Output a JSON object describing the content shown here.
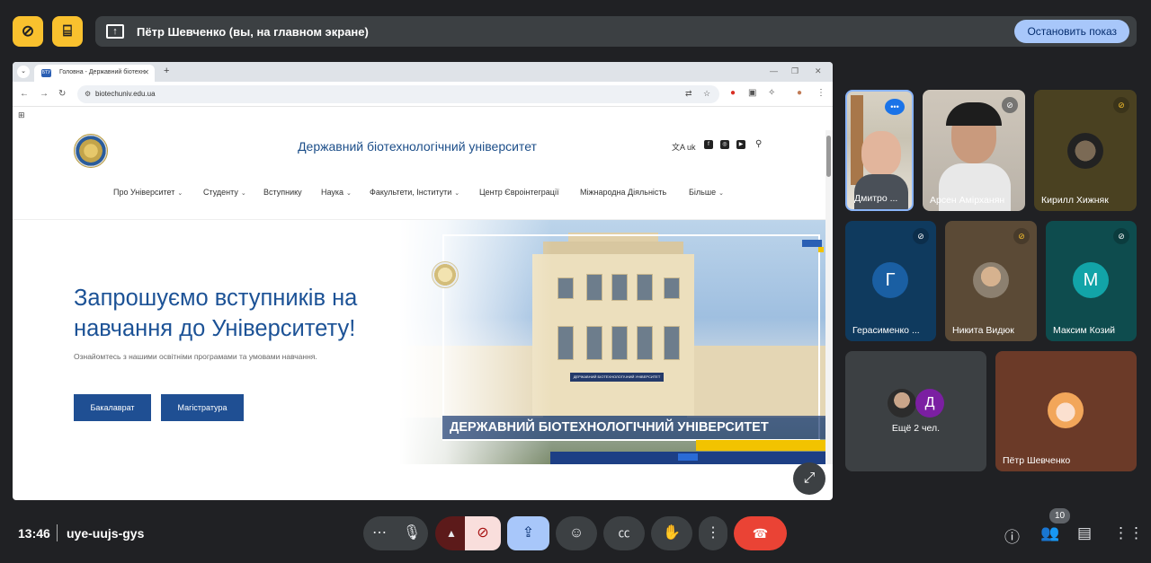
{
  "topbar": {
    "btn1_icon": "screen-share-off-icon",
    "btn2_icon": "door-icon",
    "present_icon": "present-to-all-icon",
    "present_text": "Пётр Шевченко (вы, на главном экране)",
    "stop_label": "Остановить показ"
  },
  "browser": {
    "tab_title": "Головна - Державний біотехн",
    "tab_favicon": "БТУ",
    "url": "biotechuniv.edu.ua"
  },
  "site": {
    "title": "Державний біотехнологічний університет",
    "lang": "uk",
    "menu": [
      "Про Університет",
      "Студенту",
      "Вступнику",
      "Наука",
      "Факультети, Інститути",
      "Центр Євроінтеграції",
      "Міжнародна Діяльність",
      "Більше"
    ],
    "hero_heading": "Запрошуємо вступників на навчання до Університету!",
    "hero_sub": "Ознайомтесь з нашими освітніми програмами та умовами навчання.",
    "btn_bachelor": "Бакалаврат",
    "btn_master": "Магістратура",
    "hero_banner": "ДЕРЖАВНИЙ БІОТЕХНОЛОГІЧНИЙ УНІВЕРСИТЕТ",
    "building_sign": "ДЕРЖАВНИЙ БІОТЕХНОЛОГІЧНИЙ УНІВЕРСИТЕТ"
  },
  "participants": [
    {
      "name": "Дмитро ...",
      "kind": "video"
    },
    {
      "name": "Арсен Амірханян",
      "kind": "video"
    },
    {
      "name": "Кирилл Хижняк",
      "kind": "avatar-photo"
    },
    {
      "name": "Герасименко ...",
      "initial": "Г",
      "color": "#1a5fa3"
    },
    {
      "name": "Никита Видюк",
      "kind": "avatar-photo"
    },
    {
      "name": "Максим Козий",
      "initial": "М",
      "color": "#12a4a8"
    },
    {
      "name": "Ещё 2 чел.",
      "initial": "Д",
      "color": "#7b1fa2"
    },
    {
      "name": "Пётр Шевченко",
      "kind": "avatar-photo"
    }
  ],
  "bottom": {
    "time": "13:46",
    "meeting_code": "uye-uujs-gys",
    "people_count": "10"
  },
  "colors": {
    "accent_yellow": "#f9c12e",
    "stop_btn": "#a8c7fa",
    "end_call": "#ea4335",
    "site_blue": "#1f4f93"
  }
}
